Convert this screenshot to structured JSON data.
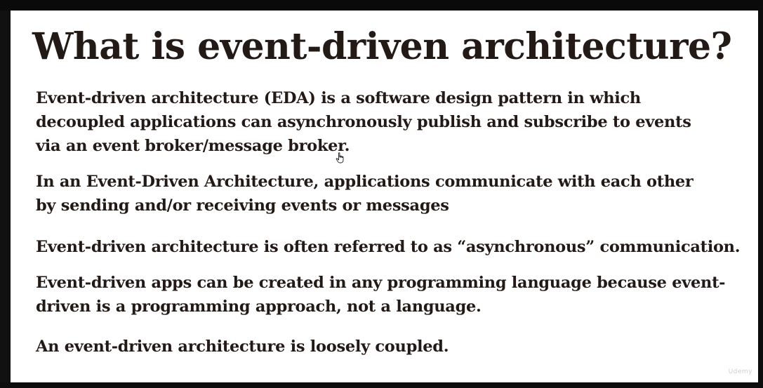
{
  "slide": {
    "title": "What is event-driven architecture?",
    "paragraphs": [
      {
        "lines": [
          "Event-driven architecture (EDA) is a software design pattern in which",
          "decoupled applications can asynchronously publish and subscribe to events",
          "via an event broker/message broker."
        ]
      },
      {
        "lines": [
          "In an Event-Driven Architecture, applications communicate with each other",
          "by sending and/or receiving events or messages"
        ]
      },
      {
        "lines": [
          "Event-driven architecture is often referred to as “asynchronous” communication."
        ]
      },
      {
        "lines": [
          "Event-driven apps can be created in any programming language because event-",
          "driven is a programming approach, not a language."
        ]
      },
      {
        "lines": [
          "An event-driven architecture is loosely coupled."
        ]
      }
    ],
    "watermark": "Udemy"
  },
  "cursor": {
    "icon": "hand-pointer-icon"
  },
  "colors": {
    "text": "#231a16",
    "slide_background": "#ffffff",
    "frame": "#0b0b0b"
  }
}
